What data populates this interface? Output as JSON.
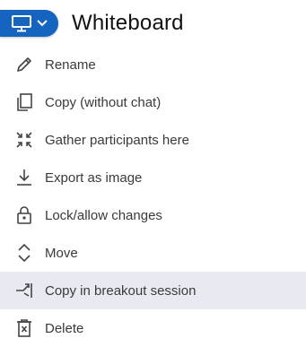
{
  "header": {
    "title": "Whiteboard",
    "toggle_icon": "presentation-icon",
    "chevron_icon": "chevron-down-icon",
    "accent": "#1565c0"
  },
  "menu": {
    "items": [
      {
        "label": "Rename",
        "icon": "pencil-icon"
      },
      {
        "label": "Copy (without chat)",
        "icon": "copy-icon"
      },
      {
        "label": "Gather participants here",
        "icon": "gather-icon"
      },
      {
        "label": "Export as image",
        "icon": "download-icon"
      },
      {
        "label": "Lock/allow changes",
        "icon": "lock-icon"
      },
      {
        "label": "Move",
        "icon": "move-icon"
      },
      {
        "label": "Copy in breakout session",
        "icon": "breakout-icon",
        "highlighted": true
      },
      {
        "label": "Delete",
        "icon": "trash-icon"
      }
    ],
    "highlight_color": "#e7ebf1"
  }
}
